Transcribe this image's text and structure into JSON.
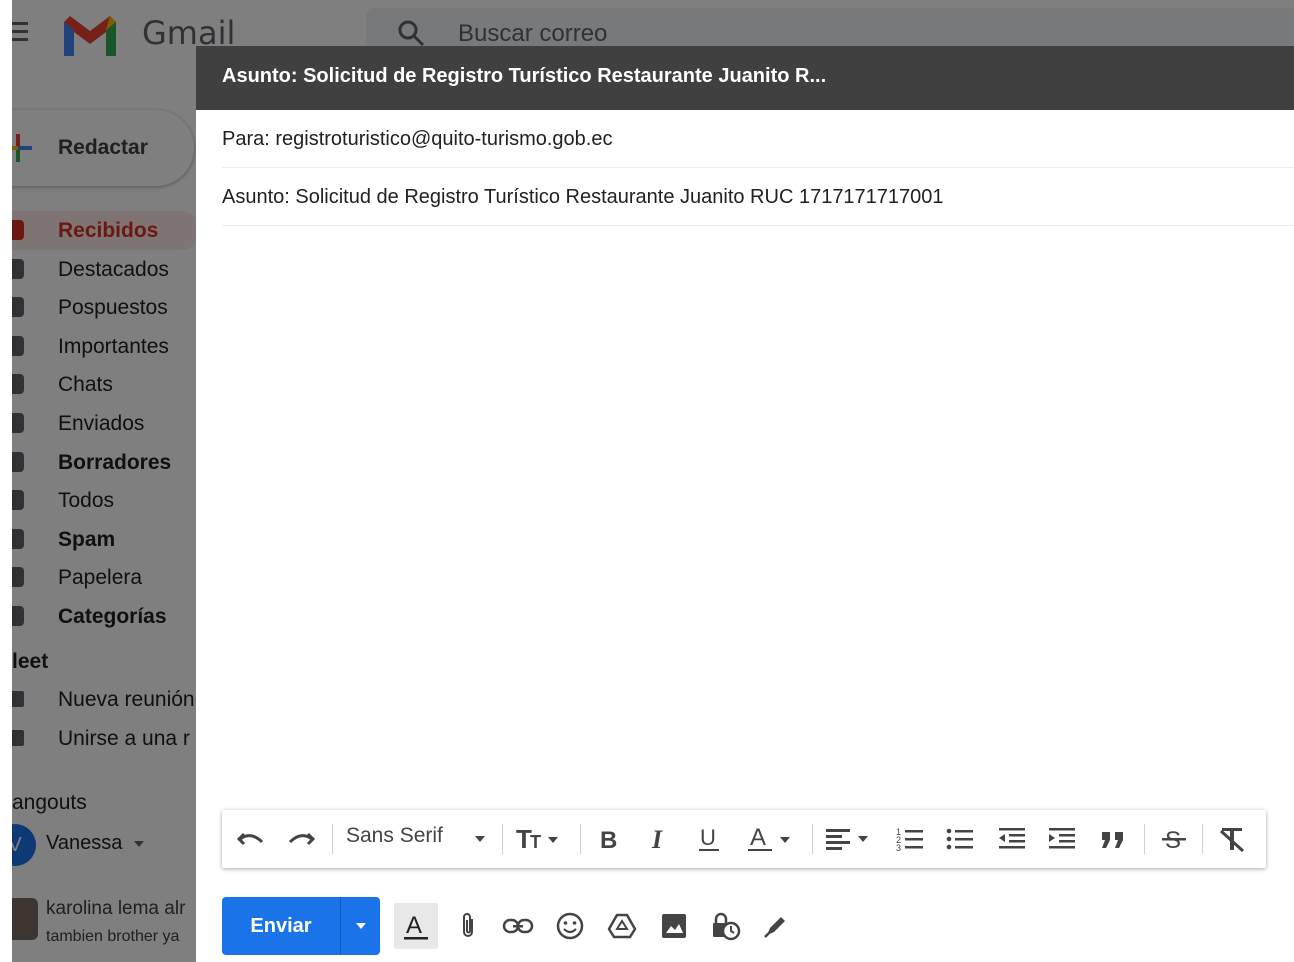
{
  "gmail": {
    "logo_text": "Gmail",
    "search_placeholder": "Buscar correo",
    "compose_label": "Redactar",
    "nav": [
      {
        "label": "Recibidos",
        "icon": "inbox-icon",
        "active": true,
        "bold": true
      },
      {
        "label": "Destacados",
        "icon": "star-icon",
        "active": false,
        "bold": false
      },
      {
        "label": "Pospuestos",
        "icon": "clock-icon",
        "active": false,
        "bold": false
      },
      {
        "label": "Importantes",
        "icon": "label-important-icon",
        "active": false,
        "bold": false
      },
      {
        "label": "Chats",
        "icon": "chat-icon",
        "active": false,
        "bold": false
      },
      {
        "label": "Enviados",
        "icon": "send-icon",
        "active": false,
        "bold": false
      },
      {
        "label": "Borradores",
        "icon": "draft-icon",
        "active": false,
        "bold": true
      },
      {
        "label": "Todos",
        "icon": "mail-icon",
        "active": false,
        "bold": false
      },
      {
        "label": "Spam",
        "icon": "report-icon",
        "active": false,
        "bold": true
      },
      {
        "label": "Papelera",
        "icon": "trash-icon",
        "active": false,
        "bold": false
      },
      {
        "label": "Categorías",
        "icon": "label-icon",
        "active": false,
        "bold": true
      }
    ],
    "meet_title": "leet",
    "meet_items": [
      {
        "label": "Nueva reunión",
        "icon": "video-icon"
      },
      {
        "label": "Unirse a una r",
        "icon": "keyboard-icon"
      }
    ],
    "hangouts_title": "angouts",
    "hangouts_user_initial": "V",
    "hangouts_user": "Vanessa",
    "chat_name": "karolina lema alr",
    "chat_message": "tambien brother ya"
  },
  "compose": {
    "title": "Asunto: Solicitud de Registro Turístico Restaurante Juanito R...",
    "to": "Para: registroturistico@quito-turismo.gob.ec",
    "subject": "Asunto: Solicitud de Registro Turístico Restaurante Juanito RUC 1717171717001",
    "font_name": "Sans Serif",
    "send_label": "Enviar"
  },
  "colors": {
    "accent": "#1a73e8",
    "active_nav": "#d93025",
    "header_bg": "#404040"
  }
}
